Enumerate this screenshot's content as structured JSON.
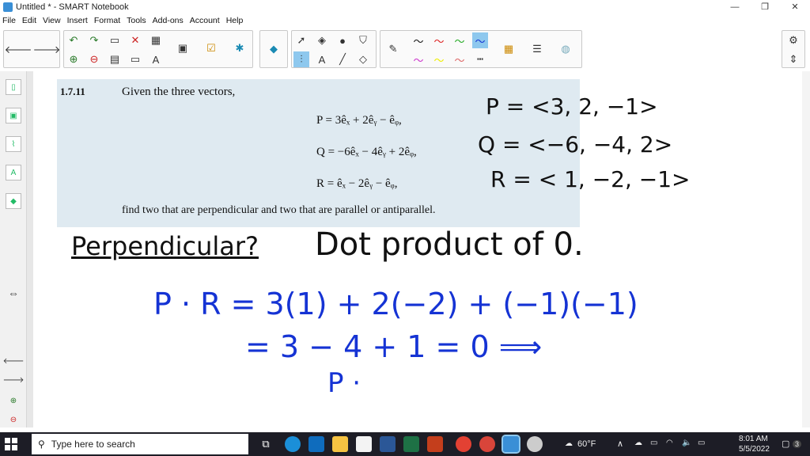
{
  "window": {
    "title": "Untitled * - SMART Notebook",
    "controls": [
      "—",
      "❐",
      "✕"
    ]
  },
  "menu": [
    "File",
    "Edit",
    "View",
    "Insert",
    "Format",
    "Tools",
    "Add-ons",
    "Account",
    "Help"
  ],
  "problem": {
    "number": "1.7.11",
    "intro": "Given the three vectors,",
    "eq_p": "P = 3êₓ + 2êᵧ − êᵩ,",
    "eq_q": "Q = −6êₓ − 4êᵧ + 2êᵩ,",
    "eq_r": "R = êₓ − 2êᵧ − êᵩ,",
    "footer": "find two that are perpendicular and two that are parallel or antiparallel."
  },
  "handwriting": {
    "p_vec": "P = <3, 2, −1>",
    "q_vec": "Q = <−6, −4, 2>",
    "r_vec": "R = < 1, −2, −1>",
    "perp": "Perpendicular?",
    "dot": "Dot product of 0.",
    "line1": "P · R = 3(1) + 2(−2) + (−1)(−1)",
    "line2": "= 3 − 4 + 1 = 0 ⟹",
    "line3": "P  ·"
  },
  "taskbar": {
    "search_placeholder": "Type here to search",
    "weather": "60°F",
    "time": "8:01 AM",
    "date": "5/5/2022",
    "notifications": "3"
  },
  "colors": {
    "ink_blue": "#1533d4",
    "ink_black": "#111111",
    "problem_bg": "#dfeaf1",
    "taskbar": "#1d1d26"
  }
}
